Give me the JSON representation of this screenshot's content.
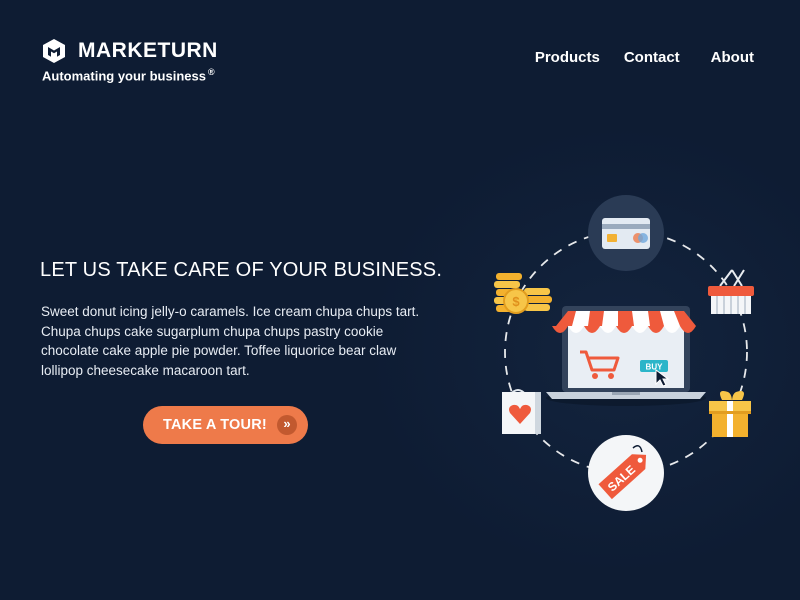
{
  "brand": {
    "name": "MARKETURN",
    "tagline": "Automating your business",
    "registered": "®"
  },
  "nav": [
    {
      "label": "Products"
    },
    {
      "label": "Contact"
    },
    {
      "label": "About"
    }
  ],
  "hero": {
    "headline": "LET US TAKE CARE OF YOUR BUSINESS.",
    "body": "Sweet donut icing jelly-o caramels. Ice cream chupa chups tart. Chupa chups cake sugarplum chupa chups pastry cookie chocolate cake apple pie powder. Toffee liquorice bear claw lollipop cheesecake macaroon tart.",
    "cta_label": "TAKE A TOUR!",
    "cta_icon": "»"
  },
  "illustration": {
    "buy_label": "BUY",
    "sale_label": "SALE"
  },
  "colors": {
    "background": "#0e1c33",
    "accent": "#ee7a4a",
    "accent_dark": "#c2592f",
    "coin": "#f7b731",
    "awning_red": "#ef5a3c"
  },
  "icons": [
    "logo-cube-icon",
    "double-chevron-right-icon",
    "credit-card-icon",
    "shopping-basket-icon",
    "gift-box-icon",
    "sale-tag-icon",
    "shopping-bag-heart-icon",
    "coins-icon",
    "shop-laptop-icon",
    "shopping-cart-icon",
    "mouse-cursor-icon"
  ]
}
